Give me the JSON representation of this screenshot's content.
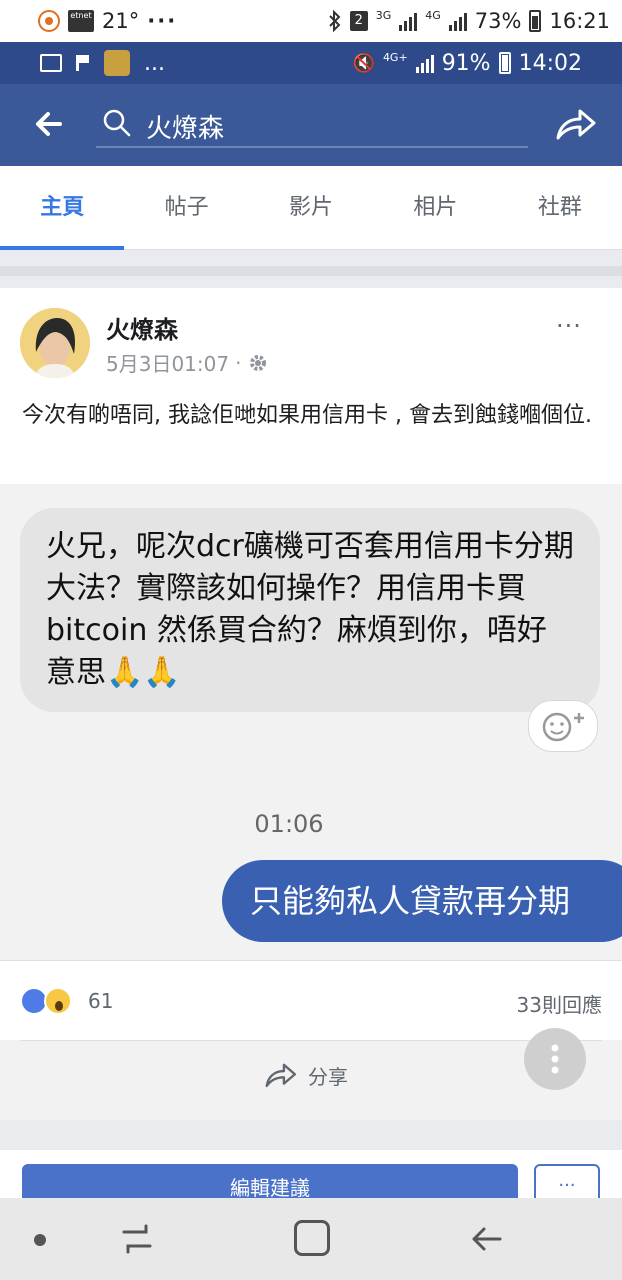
{
  "status_outer": {
    "temperature": "21°",
    "etnet_label": "etnet",
    "dots": "···",
    "sim_badge": "2",
    "net1": "3G",
    "net2": "4G",
    "battery": "73%",
    "time": "16:21"
  },
  "status_inner": {
    "dots": "...",
    "net": "4G+",
    "battery": "91%",
    "time": "14:02"
  },
  "header": {
    "search_value": "火燎森"
  },
  "tabs": [
    {
      "label": "主頁",
      "active": true
    },
    {
      "label": "帖子"
    },
    {
      "label": "影片"
    },
    {
      "label": "相片"
    },
    {
      "label": "社群"
    }
  ],
  "post": {
    "author": "火燎森",
    "date": "5月3日01:07",
    "dot": "·",
    "more": "···",
    "text": "今次有啲唔同, 我諗佢哋如果用信用卡 , 會去到蝕錢嗰個位.",
    "chat": {
      "incoming_message": "火兄，呢次dcr礦機可否套用信用卡分期大法？實際該如何操作？用信用卡買bitcoin 然係買合約？麻煩到你，唔好意思🙏🙏",
      "time": "01:06",
      "outgoing_message": "只能夠私人貸款再分期"
    },
    "reaction_count": "61",
    "comment_count": "33則回應",
    "share_label": "分享"
  },
  "suggestion": {
    "edit_label": "編輯建議",
    "more_label": "···"
  },
  "colors": {
    "fb_blue": "#3b5998",
    "tab_active": "#3578e5",
    "outgoing_bubble": "#3a60b2"
  }
}
